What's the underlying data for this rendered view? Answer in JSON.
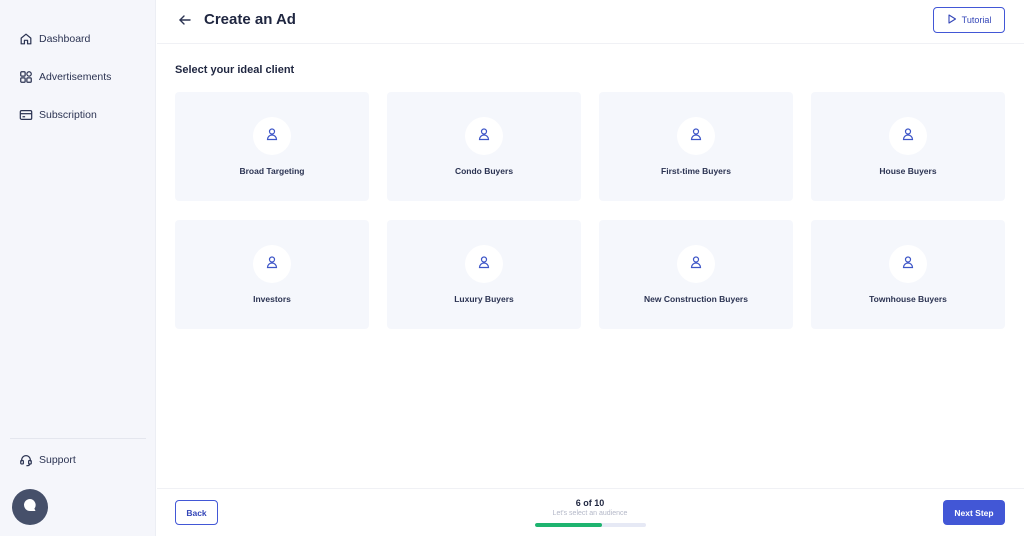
{
  "sidebar": {
    "items": [
      {
        "label": "Dashboard",
        "icon": "home-icon"
      },
      {
        "label": "Advertisements",
        "icon": "grid-icon"
      },
      {
        "label": "Subscription",
        "icon": "card-icon"
      }
    ],
    "support_label": "Support"
  },
  "header": {
    "title": "Create an Ad",
    "tutorial_label": "Tutorial"
  },
  "main": {
    "section_title": "Select your ideal client",
    "clients": [
      {
        "label": "Broad Targeting",
        "icon": "user-icon"
      },
      {
        "label": "Condo Buyers",
        "icon": "user-icon"
      },
      {
        "label": "First-time Buyers",
        "icon": "user-icon"
      },
      {
        "label": "House Buyers",
        "icon": "user-icon"
      },
      {
        "label": "Investors",
        "icon": "user-icon"
      },
      {
        "label": "Luxury Buyers",
        "icon": "user-icon"
      },
      {
        "label": "New Construction Buyers",
        "icon": "user-icon"
      },
      {
        "label": "Townhouse Buyers",
        "icon": "user-icon"
      }
    ]
  },
  "footer": {
    "back_label": "Back",
    "next_label": "Next Step",
    "step_text": "6 of 10",
    "step_subtitle": "Let's select an audience",
    "progress": 0.6
  },
  "colors": {
    "accent": "#4257d6",
    "progress": "#1eb46f",
    "card_bg": "#f5f7fc",
    "sidebar_bg": "#f5f6fb"
  }
}
